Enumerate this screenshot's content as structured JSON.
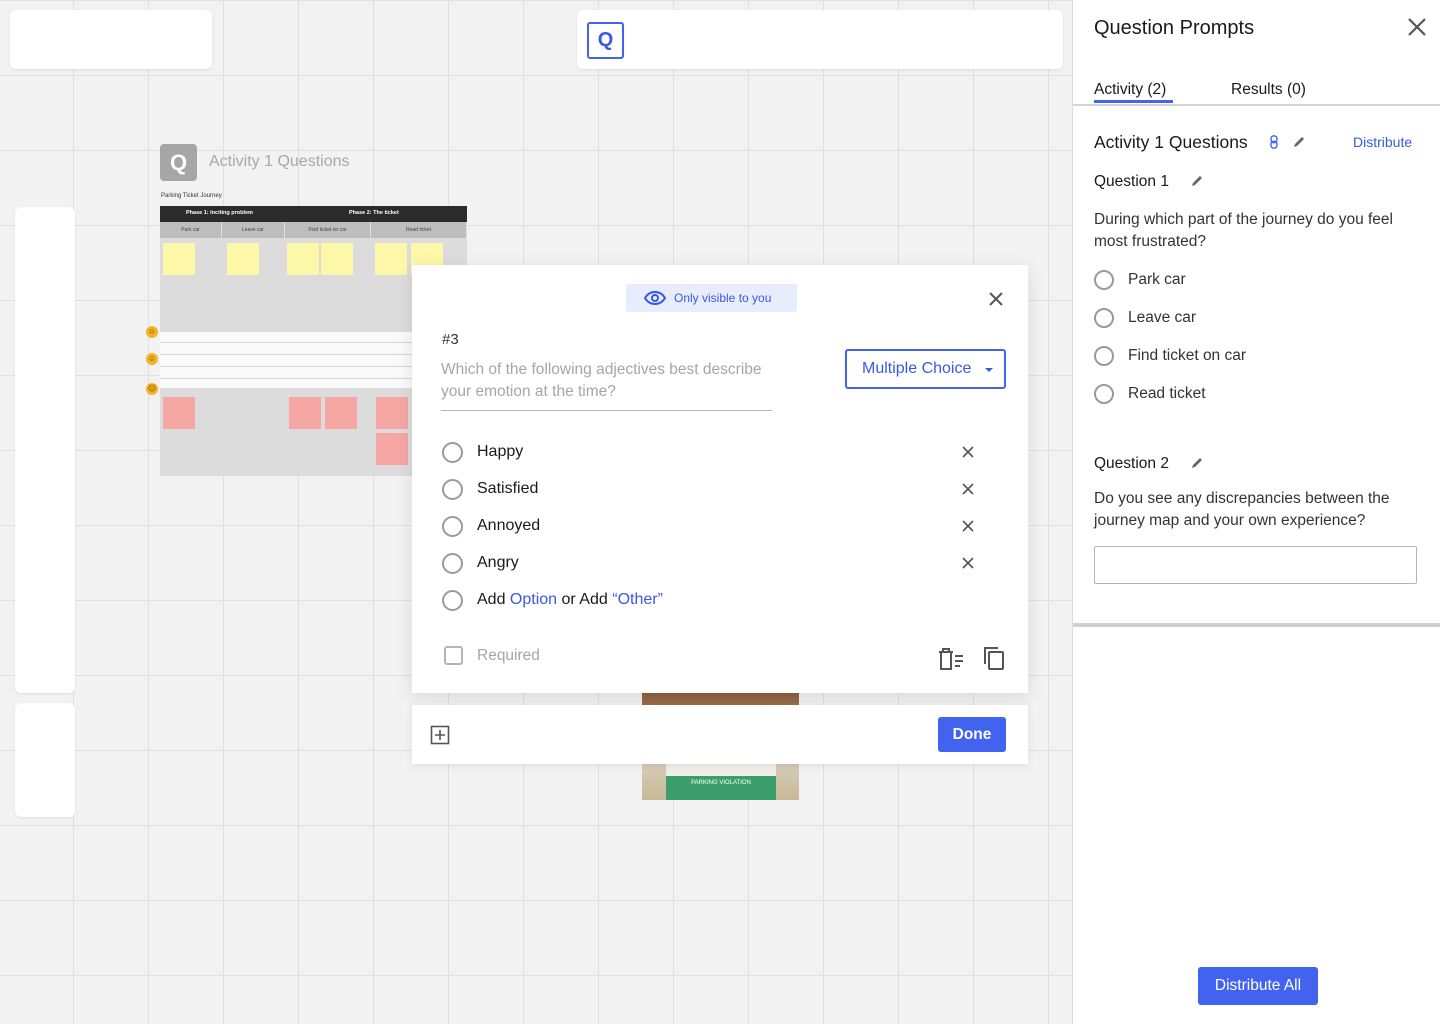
{
  "canvas": {
    "top_center_icon": "Q",
    "map": {
      "icon_letter": "Q",
      "title": "Activity 1 Questions",
      "subtitle": "Parking Ticket Journey",
      "phases": [
        "Phase 1: Inciting problem",
        "Phase 2: The ticket"
      ],
      "steps": [
        "Park car",
        "Leave car",
        "Find ticket on car",
        "Read ticket"
      ]
    },
    "photo_label": "PARKING VIOLATION"
  },
  "modal": {
    "visibility_label": "Only visible to you",
    "question_number": "#3",
    "question_text": "Which of the following adjectives best describe your emotion at the time?",
    "type_select": "Multiple Choice",
    "options": [
      "Happy",
      "Satisfied",
      "Annoyed",
      "Angry"
    ],
    "add_option": {
      "prefix": "Add",
      "option_link": "Option",
      "middle": "or Add",
      "other_link": "“Other”"
    },
    "required_label": "Required",
    "done_label": "Done"
  },
  "panel": {
    "title": "Question Prompts",
    "tabs": [
      {
        "label": "Activity (2)",
        "active": true
      },
      {
        "label": "Results (0)",
        "active": false
      }
    ],
    "activity_title": "Activity 1 Questions",
    "distribute_label": "Distribute",
    "questions": [
      {
        "label": "Question 1",
        "text": "During which part of the journey do you feel most frustrated?",
        "options": [
          "Park car",
          "Leave car",
          "Find ticket on car",
          "Read ticket"
        ]
      },
      {
        "label": "Question 2",
        "text": "Do you see any discrepancies between the journey map and your own experience?"
      }
    ],
    "distribute_all_label": "Distribute All"
  },
  "colors": {
    "accent": "#4262f0",
    "accent_text": "#3859e5",
    "badge_bg": "#e8edfd"
  },
  "icons": [
    "eye-icon",
    "close-icon",
    "chevron-down-icon",
    "delete-options-icon",
    "copy-icon",
    "add-box-icon",
    "link-icon",
    "pencil-icon"
  ]
}
